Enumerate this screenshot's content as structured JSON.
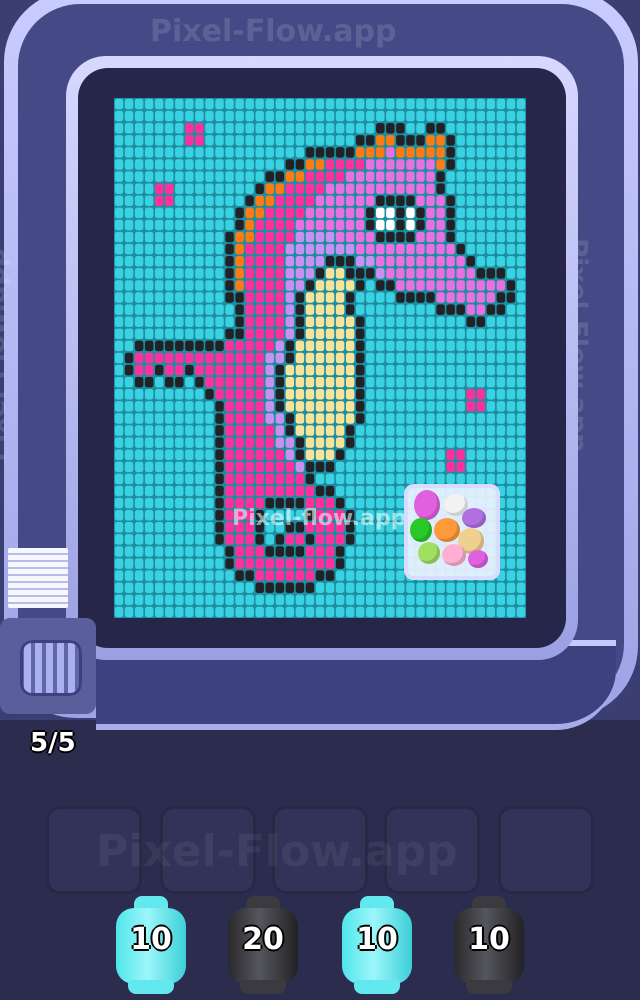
{
  "watermark": "Pixel-Flow.app",
  "watermark_center": "Pixel-flow.app",
  "queue_counter": "5/5",
  "palette": {
    "K": "#222226",
    "C": "#3ad2e2",
    "M": "#ff2f9c",
    "L": "#ea6fe0",
    "V": "#c890f0",
    "O": "#ff7a12",
    "Y": "#f7e49a",
    "W": "#ffffff"
  },
  "pixel_grid": [
    "CCCCCCCCCCCCCCCCCCCCCCCCCCCCCCCCCCCCCCCCC",
    "CCCCCCCCCCCCCCCCCCCCCCCCCCCCCCCCCCCCCCCCC",
    "CCCCCCCMMCCCCCCCCCCCCCCCCCKKKCCKKCCCCCCCC",
    "CCCCCCCMMCCCCCCCCCCCCCCCKKOOKKKOOKCCCCCCC",
    "CCCCCCCCCCCCCCCCCCCKKKKKOOOLOOOOOKCCCCCCC",
    "CCCCCCCCCCCCCCCCCKKOOMMMMLLLLLLLOKCCCCCCC",
    "CCCCCCCCCCCCCCCKKOOMMMMLLLLLLLLLKCCCCCCCC",
    "CCCCMMCCCCCCCCKOOMMMMLLLLLLLLLLLKCCCCCCCC",
    "CCCCMMCCCCCCCKOOMMMMLLLLLLKKKKLLLKCCCCCCC",
    "CCCCCCCCCCCCKOOMMMMLLLLLLKWWKWKLLKCCCCCCC",
    "CCCCCCCCCCCCKOMMMMLLLLLLLKWWKWKLLKCCCCCCC",
    "CCCCCCCCCCCKOOMMMMVVVVLLLLKKKKLLLKCCCCCCC",
    "CCCCCCCCCCCKOMMMMVVVVVVVLLLLLLLLLLKCCCCCC",
    "CCCCCCCCCCCKOMMMMVVVVKKKVVLLLLLLLLLKCCCCC",
    "CCCCCCCCCCCKOMMMMVVVKYYKKKVLLLLLLLLLKKKCC",
    "CCCCCCCCCCCKOMMMMVVKYYYYKCKKLLLLLLLLLLLKC",
    "CCCCCCCCCCCKKMMMMVKYYYYKCCCCKKKKLLLLLLKKC",
    "CCCCCCCCCCCCKMMMMVKYYYYKCCCCCCCCKKKLLKKCC",
    "CCCCCCCCCCCCKMMMMVKYYYYYKCCCCCCCCCCKKCCCC",
    "CCCCCCCCCCCKKMMMMVKYYYYYKCCCCCCCCCCCCCCCC",
    "CCKKKKKKKKKMMMMMVKYYYYYYKCCCCCCCCCCCCCCCC",
    "CKMMMMMMMMMMMMMVVKYYYYYYKCCCCCCCCCCCCCCCC",
    "CKMMKMMKMMMMMMMVKYYYYYYYKCCCCCCCCCCCCCCCC",
    "CCKKCKKCKMMMMMMVKYYYYYYYKCCCCCCCCCCCCCCCC",
    "CCCCCCCCCKMMMMMVKYYYYYYYKCCCCCCCCCCMMCCCC",
    "CCCCCCCCCCKMMMMVKYYYYYYYKCCCCCCCCCCMMCCCC",
    "CCCCCCCCCCKMMMMVVKYYYYYYKCCCCCCCCCCCCCCCC",
    "CCCCCCCCCCKMMMMMVKYYYYYKCCCCCCCCCCCCCCCCC",
    "CCCCCCCCCCKMMMMMVVKYYYYKCCCCCCCCCCCCCCCCC",
    "CCCCCCCCCCKMMMMMMVKYYYKCCCCCCCCCCMMCCCCCC",
    "CCCCCCCCCCKMMMMMMMVKKKCCCCCCCCCCCMMCCCCCC",
    "CCCCCCCCCCKMMMMMMMMKCCCCCCCCCCCCCCCCCCCCC",
    "CCCCCCCCCCKMMMMMMMMMKKCCCCCCCCCCCCCCCCCCC",
    "CCCCCCCCCCKMMMMKKKKMMMKCCCCCCCCCCCCCCCCCC",
    "CCCCCCCCCCKMMMKCCCCKMMMKCCCCCCCCCCCCCCCCC",
    "CCCCCCCCCCKMMMKCCKKMMMMKCCCCCCCCCCCCCCCCC",
    "CCCCCCCCCCKMMMKCKMMKMMMKCCCCCCCCCCCCCCCCC",
    "CCCCCCCCCCCKMMMKKKKMMMKCCCCCCCCCCCCCCCCCC",
    "CCCCCCCCCCCKMMMMMMMMMMKCCCCCCCCCCCCCCCCCC",
    "CCCCCCCCCCCCKKMMMMMMKKCCCCCCCCCCCCCCCCCCC",
    "CCCCCCCCCCCCCCKKKKKKCCCCCCCCCCCCCCCCCCCCC",
    "CCCCCCCCCCCCCCCCCCCCCCCCCCCCCCCCCCCCCCCCC",
    "CCCCCCCCCCCCCCCCCCCCCCCCCCCCCCCCCCCCCCCCC"
  ],
  "shooters": [
    {
      "value": "10",
      "color": "cyan"
    },
    {
      "value": "20",
      "color": "black"
    },
    {
      "value": "10",
      "color": "cyan"
    },
    {
      "value": "10",
      "color": "black"
    }
  ],
  "jelly_bean_colors": [
    "#e060e0",
    "#f2f2f2",
    "#b070e0",
    "#28c828",
    "#ff9a3a",
    "#f0d090",
    "#a0e060",
    "#ffb0d0"
  ]
}
